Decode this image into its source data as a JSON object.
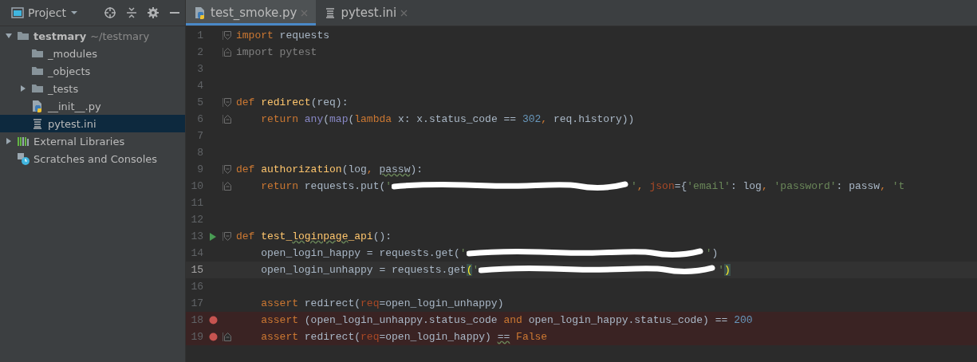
{
  "sidebar": {
    "title": "Project",
    "tree": [
      {
        "name": "testmary",
        "hint": "~/testmary",
        "kind": "folder",
        "bold": true,
        "expanded": true,
        "selected": false,
        "children": [
          {
            "name": "_modules",
            "kind": "folder",
            "selected": false
          },
          {
            "name": "_objects",
            "kind": "folder",
            "selected": false
          },
          {
            "name": "_tests",
            "kind": "folder",
            "expanded": false,
            "selected": false
          },
          {
            "name": "__init__.py",
            "kind": "python",
            "selected": false
          },
          {
            "name": "pytest.ini",
            "kind": "ini",
            "selected": true
          }
        ]
      },
      {
        "name": "External Libraries",
        "kind": "library",
        "expanded": false,
        "selected": false
      },
      {
        "name": "Scratches and Consoles",
        "kind": "scratches",
        "selected": false
      }
    ]
  },
  "tabs": [
    {
      "label": "test_smoke.py",
      "kind": "python",
      "selected": true
    },
    {
      "label": "pytest.ini",
      "kind": "ini",
      "selected": false
    }
  ],
  "editor": {
    "lines": [
      {
        "number": "1",
        "fold_open": true,
        "tokens": [
          {
            "kind": "keyword",
            "t": "import"
          },
          {
            "kind": "plain",
            "t": " requests"
          }
        ]
      },
      {
        "number": "2",
        "fold_close": true,
        "tokens": [
          {
            "kind": "unused",
            "t": "import pytest"
          }
        ]
      },
      {
        "number": "3"
      },
      {
        "number": "4"
      },
      {
        "number": "5",
        "fold_open": true,
        "tokens": [
          {
            "kind": "keyword",
            "t": "def"
          },
          {
            "kind": "function",
            "t": " redirect"
          },
          {
            "kind": "plain",
            "t": "(req):"
          }
        ]
      },
      {
        "number": "6",
        "fold_close": true,
        "tokens": [
          {
            "kind": "keyword",
            "t": "    return"
          },
          {
            "kind": "builtin",
            "t": " any"
          },
          {
            "kind": "plain",
            "t": "("
          },
          {
            "kind": "builtin",
            "t": "map"
          },
          {
            "kind": "plain",
            "t": "("
          },
          {
            "kind": "keyword",
            "t": "lambda"
          },
          {
            "kind": "plain",
            "t": " x: x.status_code == "
          },
          {
            "kind": "number",
            "t": "302"
          },
          {
            "kind": "keyword",
            "t": ","
          },
          {
            "kind": "plain",
            "t": " req.history))"
          }
        ]
      },
      {
        "number": "7"
      },
      {
        "number": "8"
      },
      {
        "number": "9",
        "fold_open": true,
        "tokens": [
          {
            "kind": "keyword",
            "t": "def"
          },
          {
            "kind": "function",
            "t": " authorization"
          },
          {
            "kind": "plain",
            "t": "(log"
          },
          {
            "kind": "keyword",
            "t": ", "
          },
          {
            "kind": "warning",
            "t": "passw"
          },
          {
            "kind": "plain",
            "t": "):"
          }
        ]
      },
      {
        "number": "10",
        "fold_close": true,
        "tokens": [
          {
            "kind": "keyword",
            "t": "    return"
          },
          {
            "kind": "plain",
            "t": " requests.put("
          },
          {
            "kind": "string",
            "t": "'"
          },
          {
            "kind": "redacted"
          },
          {
            "kind": "string",
            "t": "'"
          },
          {
            "kind": "keyword",
            "t": ","
          },
          {
            "kind": "param",
            "t": " json"
          },
          {
            "kind": "plain",
            "t": "={"
          },
          {
            "kind": "string",
            "t": "'email'"
          },
          {
            "kind": "plain",
            "t": ": log"
          },
          {
            "kind": "keyword",
            "t": ","
          },
          {
            "kind": "string",
            "t": " 'password'"
          },
          {
            "kind": "plain",
            "t": ": passw"
          },
          {
            "kind": "keyword",
            "t": ","
          },
          {
            "kind": "string",
            "t": " 't"
          }
        ]
      },
      {
        "number": "11"
      },
      {
        "number": "12"
      },
      {
        "number": "13",
        "fold_open": true,
        "run_marker": true,
        "tokens": [
          {
            "kind": "keyword",
            "t": "def"
          },
          {
            "kind": "function",
            "t": " test_"
          },
          {
            "kind": "function_warning",
            "t": "loginpage"
          },
          {
            "kind": "function",
            "t": "_api"
          },
          {
            "kind": "plain",
            "t": "():"
          }
        ]
      },
      {
        "number": "14",
        "tokens": [
          {
            "kind": "plain",
            "t": "    open_login_happy = requests.get("
          },
          {
            "kind": "string",
            "t": "'"
          },
          {
            "kind": "redacted"
          },
          {
            "kind": "string",
            "t": "'"
          },
          {
            "kind": "plain",
            "t": ")"
          }
        ]
      },
      {
        "number": "15",
        "current": true,
        "tokens": [
          {
            "kind": "plain",
            "t": "    open_login_unhappy = requests.get"
          },
          {
            "kind": "brace",
            "t": "("
          },
          {
            "kind": "string",
            "t": "'"
          },
          {
            "kind": "redacted"
          },
          {
            "kind": "string",
            "t": "'"
          },
          {
            "kind": "brace",
            "t": ")"
          }
        ]
      },
      {
        "number": "16"
      },
      {
        "number": "17",
        "tokens": [
          {
            "kind": "keyword",
            "t": "    assert"
          },
          {
            "kind": "plain",
            "t": " redirect("
          },
          {
            "kind": "param",
            "t": "req"
          },
          {
            "kind": "plain",
            "t": "=open_login_unhappy)"
          }
        ]
      },
      {
        "number": "18",
        "breakpoint": true,
        "tokens": [
          {
            "kind": "keyword",
            "t": "    assert"
          },
          {
            "kind": "plain",
            "t": " (open_login_unhappy.status_code "
          },
          {
            "kind": "keyword",
            "t": "and"
          },
          {
            "kind": "plain",
            "t": " open_login_happy.status_code) == "
          },
          {
            "kind": "number",
            "t": "200"
          }
        ]
      },
      {
        "number": "19",
        "fold_close": true,
        "breakpoint": true,
        "tokens": [
          {
            "kind": "keyword",
            "t": "    assert"
          },
          {
            "kind": "plain",
            "t": " redirect("
          },
          {
            "kind": "param",
            "t": "req"
          },
          {
            "kind": "plain",
            "t": "=open_login_happy) "
          },
          {
            "kind": "warning",
            "t": "=="
          },
          {
            "kind": "keyword",
            "t": " False"
          }
        ]
      }
    ]
  }
}
